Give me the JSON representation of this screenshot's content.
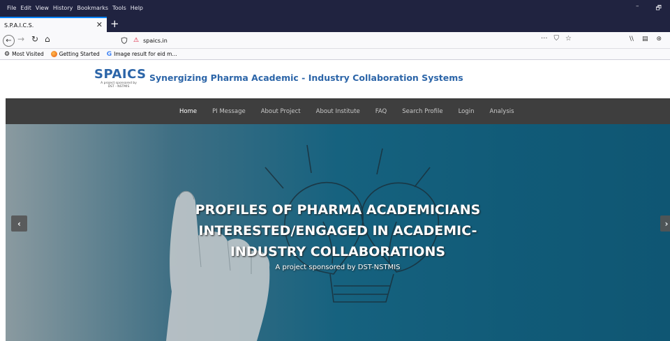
{
  "browser": {
    "menu": [
      "File",
      "Edit",
      "View",
      "History",
      "Bookmarks",
      "Tools",
      "Help"
    ],
    "window_controls": [
      "–",
      "🗗"
    ],
    "tab_title": "S.P.A.I.C.S.",
    "tab_close": "✕",
    "new_tab": "+",
    "url": "spaics.in",
    "url_tools": [
      "···",
      "⛉",
      "☆"
    ],
    "toolbar_right": [
      "\\\\",
      "▤",
      "⊛"
    ],
    "bookmarks": [
      {
        "icon": "gear-icon",
        "label": "Most Visited"
      },
      {
        "icon": "firefox-icon",
        "label": "Getting Started"
      },
      {
        "icon": "google-icon",
        "label": "Image result for eid m..."
      }
    ],
    "accent_color": "#0a84ff"
  },
  "site": {
    "logo_word": "SPAICS",
    "logo_sub1": "A project sponsored by",
    "logo_sub2": "DST - NSTMIS",
    "title": "Synergizing Pharma Academic - Industry Collaboration Systems",
    "title_color": "#2c65a8",
    "nav": [
      {
        "label": "Home",
        "active": true
      },
      {
        "label": "PI Message",
        "active": false
      },
      {
        "label": "About Project",
        "active": false
      },
      {
        "label": "About Institute",
        "active": false
      },
      {
        "label": "FAQ",
        "active": false
      },
      {
        "label": "Search Profile",
        "active": false
      },
      {
        "label": "Login",
        "active": false
      },
      {
        "label": "Analysis",
        "active": false
      }
    ],
    "nav_bg": "#3e3e3e"
  },
  "hero": {
    "heading_lines": [
      "PROFILES OF PHARMA ACADEMICIANS",
      "INTERESTED/ENGAGED IN ACADEMIC-",
      "INDUSTRY COLLABORATIONS"
    ],
    "subtitle": "A project sponsored by DST-NSTMIS",
    "prev": "‹",
    "next": "›",
    "bg_color": "#16627f"
  }
}
